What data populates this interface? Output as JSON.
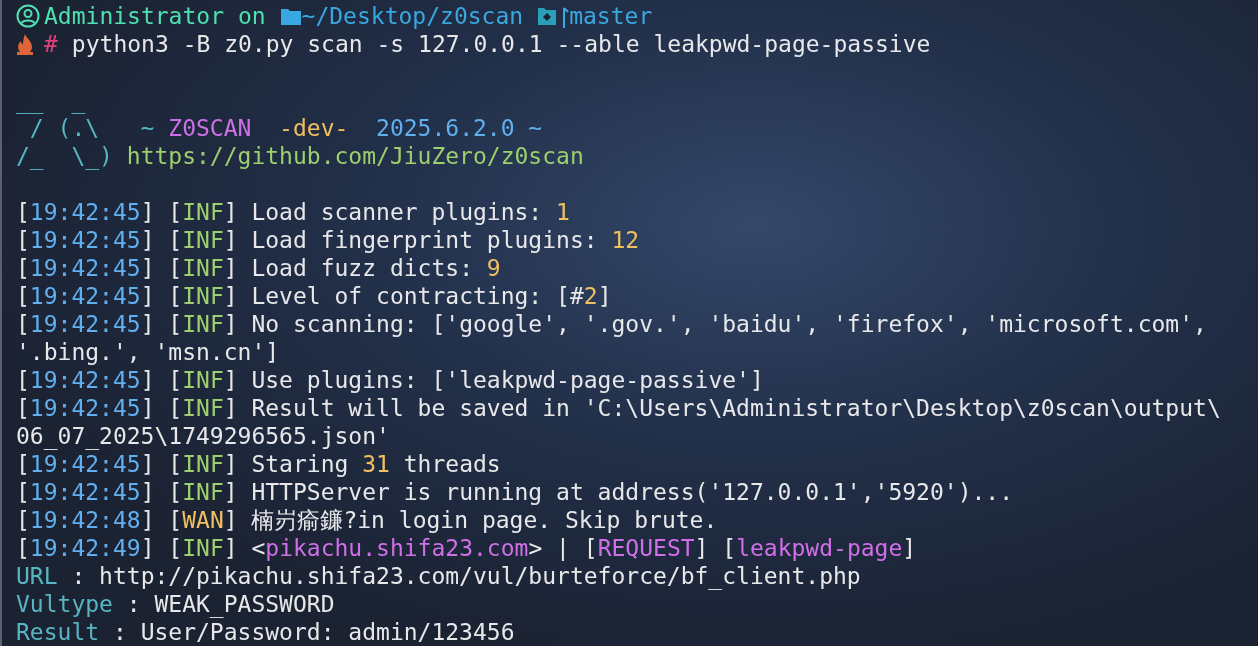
{
  "terminal": {
    "lines": [
      {
        "kind": "prompt",
        "user": "Administrator",
        "joiner": "on",
        "path": "~/Desktop/z0scan",
        "branch": "master"
      },
      {
        "kind": "command",
        "symbol": "#",
        "text": "python3 -B z0.py scan -s 127.0.0.1 --able leakpwd-page-passive"
      },
      {
        "kind": "blank"
      },
      {
        "kind": "banner-art",
        "art": "__  _"
      },
      {
        "kind": "banner-title",
        "art": " / (.\\   ~ ",
        "name": "Z0SCAN",
        "channel": "  -dev-  ",
        "version": "2025.6.2.0 ~"
      },
      {
        "kind": "banner-url",
        "art": "/_  \\_) ",
        "url": "https://github.com/JiuZero/z0scan"
      },
      {
        "kind": "blank"
      },
      {
        "kind": "log-info",
        "parts": [
          {
            "kind": "text",
            "text": "["
          },
          {
            "kind": "time",
            "text": "19:42:45"
          },
          {
            "kind": "text",
            "text": "] ["
          },
          {
            "kind": "level",
            "text": "INF"
          },
          {
            "kind": "text",
            "text": "] Load scanner plugins: "
          },
          {
            "kind": "number",
            "text": "1"
          }
        ]
      },
      {
        "kind": "log-info",
        "parts": [
          {
            "kind": "text",
            "text": "["
          },
          {
            "kind": "time",
            "text": "19:42:45"
          },
          {
            "kind": "text",
            "text": "] ["
          },
          {
            "kind": "level",
            "text": "INF"
          },
          {
            "kind": "text",
            "text": "] Load fingerprint plugins: "
          },
          {
            "kind": "number",
            "text": "12"
          }
        ]
      },
      {
        "kind": "log-info",
        "parts": [
          {
            "kind": "text",
            "text": "["
          },
          {
            "kind": "time",
            "text": "19:42:45"
          },
          {
            "kind": "text",
            "text": "] ["
          },
          {
            "kind": "level",
            "text": "INF"
          },
          {
            "kind": "text",
            "text": "] Load fuzz dicts: "
          },
          {
            "kind": "number",
            "text": "9"
          }
        ]
      },
      {
        "kind": "log-info",
        "parts": [
          {
            "kind": "text",
            "text": "["
          },
          {
            "kind": "time",
            "text": "19:42:45"
          },
          {
            "kind": "text",
            "text": "] ["
          },
          {
            "kind": "level",
            "text": "INF"
          },
          {
            "kind": "text",
            "text": "] Level of contracting: [#"
          },
          {
            "kind": "number",
            "text": "2"
          },
          {
            "kind": "text",
            "text": "]"
          }
        ]
      },
      {
        "kind": "log-info",
        "parts": [
          {
            "kind": "text",
            "text": "["
          },
          {
            "kind": "time",
            "text": "19:42:45"
          },
          {
            "kind": "text",
            "text": "] ["
          },
          {
            "kind": "level",
            "text": "INF"
          },
          {
            "kind": "text",
            "text": "] No scanning: ['google', '.gov.', 'baidu', 'firefox', 'microsoft.com',"
          }
        ]
      },
      {
        "kind": "continuation",
        "text": "'.bing.', 'msn.cn']"
      },
      {
        "kind": "log-info",
        "parts": [
          {
            "kind": "text",
            "text": "["
          },
          {
            "kind": "time",
            "text": "19:42:45"
          },
          {
            "kind": "text",
            "text": "] ["
          },
          {
            "kind": "level",
            "text": "INF"
          },
          {
            "kind": "text",
            "text": "] Use plugins: ['leakpwd-page-passive']"
          }
        ]
      },
      {
        "kind": "log-info",
        "parts": [
          {
            "kind": "text",
            "text": "["
          },
          {
            "kind": "time",
            "text": "19:42:45"
          },
          {
            "kind": "text",
            "text": "] ["
          },
          {
            "kind": "level",
            "text": "INF"
          },
          {
            "kind": "text",
            "text": "] Result will be saved in 'C:\\Users\\Administrator\\Desktop\\z0scan\\output\\"
          }
        ]
      },
      {
        "kind": "continuation",
        "text": "06_07_2025\\1749296565.json'"
      },
      {
        "kind": "log-info",
        "parts": [
          {
            "kind": "text",
            "text": "["
          },
          {
            "kind": "time",
            "text": "19:42:45"
          },
          {
            "kind": "text",
            "text": "] ["
          },
          {
            "kind": "level",
            "text": "INF"
          },
          {
            "kind": "text",
            "text": "] Staring "
          },
          {
            "kind": "number",
            "text": "31"
          },
          {
            "kind": "text",
            "text": " threads"
          }
        ]
      },
      {
        "kind": "log-info",
        "parts": [
          {
            "kind": "text",
            "text": "["
          },
          {
            "kind": "time",
            "text": "19:42:45"
          },
          {
            "kind": "text",
            "text": "] ["
          },
          {
            "kind": "level",
            "text": "INF"
          },
          {
            "kind": "text",
            "text": "] HTTPServer is running at address('127.0.0.1','5920')..."
          }
        ]
      },
      {
        "kind": "log-warning",
        "parts": [
          {
            "kind": "text",
            "text": "["
          },
          {
            "kind": "time",
            "text": "19:42:48"
          },
          {
            "kind": "text",
            "text": "] ["
          },
          {
            "kind": "level",
            "text": "WAN"
          },
          {
            "kind": "text",
            "text": "] 楠岃瘉鐮?in login page. Skip brute."
          }
        ]
      },
      {
        "kind": "log-info",
        "parts": [
          {
            "kind": "text",
            "text": "["
          },
          {
            "kind": "time",
            "text": "19:42:49"
          },
          {
            "kind": "text",
            "text": "] ["
          },
          {
            "kind": "level",
            "text": "INF"
          },
          {
            "kind": "text",
            "text": "] <"
          },
          {
            "kind": "highlight",
            "text": "pikachu.shifa23.com"
          },
          {
            "kind": "text",
            "text": "> | ["
          },
          {
            "kind": "highlight",
            "text": "REQUEST"
          },
          {
            "kind": "text",
            "text": "] ["
          },
          {
            "kind": "highlight",
            "text": "leakpwd-page"
          },
          {
            "kind": "text",
            "text": "]"
          }
        ]
      },
      {
        "kind": "field",
        "label": "URL",
        "value": " : http://pikachu.shifa23.com/vul/burteforce/bf_client.php"
      },
      {
        "kind": "field",
        "label": "Vultype",
        "value": " : WEAK_PASSWORD"
      },
      {
        "kind": "field",
        "label": "Result",
        "value": " : User/Password: admin/123456"
      }
    ]
  }
}
